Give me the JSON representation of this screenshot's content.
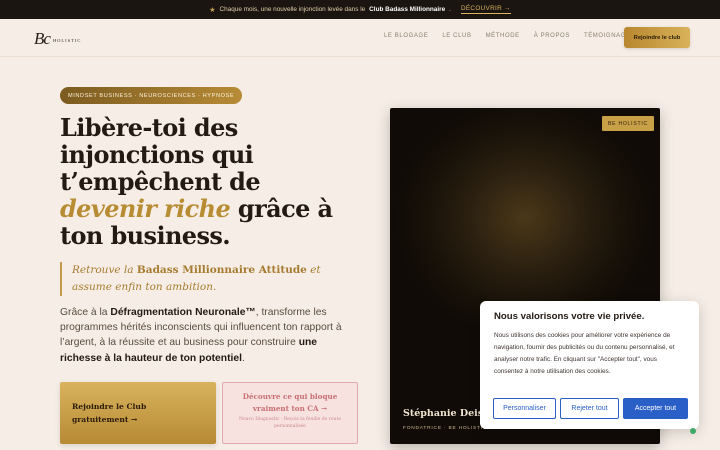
{
  "topbar": {
    "star": "★",
    "text": "Chaque mois, une nouvelle injonction levée dans le",
    "club": "Club Badass Millionnaire",
    "dot": ".",
    "cta": "DÉCOUVRIR →"
  },
  "header": {
    "logo_mark": "Bc",
    "logo_text": "HOLISTIC",
    "nav": [
      "LE BLOGAGE",
      "LE CLUB",
      "MÉTHODE",
      "À PROPOS",
      "TÉMOIGNAGES"
    ],
    "join_button": "Rejoindre le club"
  },
  "hero": {
    "badge": "MINDSET BUSINESS · NEUROSCIENCES · HYPNOSE",
    "title_part1": "Libère-toi des injonctions qui t’empêchent de",
    "title_accent": "devenir riche",
    "title_part2": "grâce à ton business.",
    "quote_part1": "Retrouve la",
    "quote_bold": "Badass Millionnaire Attitude",
    "quote_part2": "et assume enfin ton ambition.",
    "desc_part1": "Grâce à la",
    "desc_bold1": "Défragmentation Neuronale™",
    "desc_part2": ", transforme les programmes hérités inconscients qui influencent ton rapport à l’argent, à la réussite et au business pour construire",
    "desc_bold2": "une richesse à la hauteur de ton potentiel",
    "desc_part3": ".",
    "cta_primary": "Rejoindre le Club gratuitement →",
    "cta_secondary_title": "Découvre ce qui bloque vraiment ton CA →",
    "cta_secondary_sub": "Nouvo Diagnostic · Reçois ta feuille de route personnalisée"
  },
  "hero_image": {
    "badge": "BE HOLISTIC",
    "name": "Stéphanie Deiss",
    "role": "FONDATRICE · BE HOLISTIC"
  },
  "cookie": {
    "title": "Nous valorisons votre vie privée.",
    "text": "Nous utilisons des cookies pour améliorer votre expérience de navigation, fournir des publicités ou du contenu personnalisé, et analyser notre trafic. En cliquant sur \"Accepter tout\", vous consentez à notre utilisation des cookies.",
    "customize": "Personnaliser",
    "reject": "Rejeter tout",
    "accept": "Accepter tout"
  },
  "colors": {
    "gold": "#b88c33",
    "dark": "#1b1511",
    "cookie_blue": "#2a5fc8",
    "background": "#f6eee6"
  }
}
